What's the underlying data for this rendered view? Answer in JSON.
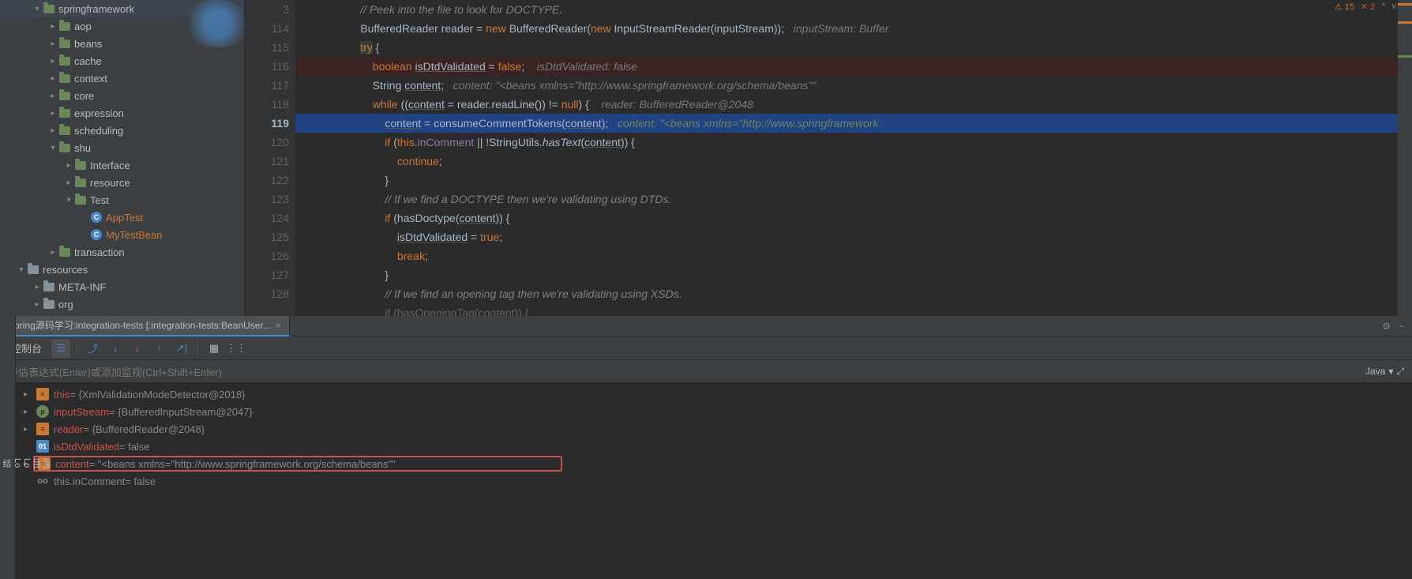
{
  "tree": {
    "springframework": "springframework",
    "aop": "aop",
    "beans": "beans",
    "cache": "cache",
    "context": "context",
    "core": "core",
    "expression": "expression",
    "scheduling": "scheduling",
    "shu": "shu",
    "interface": "Interface",
    "resource": "resource",
    "test": "Test",
    "apptest": "AppTest",
    "mytestbean": "MyTestBean",
    "transaction": "transaction",
    "resources": "resources",
    "metainf": "META-INF",
    "org": "org"
  },
  "gutter": [
    "3",
    "114",
    "115",
    "116",
    "117",
    "118",
    "119",
    "120",
    "121",
    "122",
    "123",
    "124",
    "125",
    "126",
    "127",
    "128",
    ""
  ],
  "code": {
    "l0": {
      "indent": "                ",
      "c": "// Peek into the file to look for DOCTYPE."
    },
    "l1": {
      "indent": "                ",
      "a": "BufferedReader reader = ",
      "b": "new",
      "c": " BufferedReader(",
      "d": "new",
      "e": " InputStreamReader(inputStream));",
      "inlay": "   inputStream: Buffer"
    },
    "l2": {
      "indent": "                ",
      "a": "try",
      "b": " {"
    },
    "l3": {
      "indent": "                    ",
      "a": "boolean ",
      "b": "isDtdValidated",
      "c": " = ",
      "d": "false",
      "e": ";",
      "inlay": "    isDtdValidated: false"
    },
    "l4": {
      "indent": "                    ",
      "a": "String ",
      "b": "content",
      "c": ";",
      "inlay": "   content: \"<beans xmlns=\"http://www.springframework.org/schema/beans\"\""
    },
    "l5": {
      "indent": "                    ",
      "a": "while ",
      "b": "((",
      "c": "content",
      "d": " = reader.readLine()) != ",
      "e": "null",
      "f": ") {",
      "inlay": "    reader: BufferedReader@2048"
    },
    "l6": {
      "indent": "                        ",
      "a": "content",
      "b": " = consumeCommentTokens(",
      "c": "content",
      "d": ");",
      "inlay": "   content: \"<beans xmlns=\"http://www.springframework"
    },
    "l7": {
      "indent": "                        ",
      "a": "if ",
      "b": "(",
      "c": "this",
      "d": ".",
      "e": "inComment",
      "f": " || !StringUtils.",
      "g": "hasText",
      "h": "(",
      "i": "content",
      "j": ")) {"
    },
    "l8": {
      "indent": "                            ",
      "a": "continue",
      "b": ";"
    },
    "l9": {
      "indent": "                        ",
      "a": "}"
    },
    "l10": {
      "indent": "                        ",
      "c": "// If we find a DOCTYPE then we're validating using DTDs."
    },
    "l11": {
      "indent": "                        ",
      "a": "if ",
      "b": "(hasDoctype(",
      "c": "content",
      "d": ")) {"
    },
    "l12": {
      "indent": "                            ",
      "a": "isDtdValidated",
      "b": " = ",
      "c": "true",
      "d": ";"
    },
    "l13": {
      "indent": "                            ",
      "a": "break",
      "b": ";"
    },
    "l14": {
      "indent": "                        ",
      "a": "}"
    },
    "l15": {
      "indent": "                        ",
      "c": "// If we find an opening tag then we're validating using XSDs."
    },
    "l16": {
      "indent": "                        ",
      "a": "if (hasOpeningTag(content)) {"
    }
  },
  "tab": {
    "title": "Spring源码学习:integration-tests [:integration-tests:BeanUser...",
    "close": "×",
    "gear": "⚙",
    "min": "−"
  },
  "toolbar": {
    "console": "控制台"
  },
  "eval": {
    "placeholder": "评估表达式(Enter)或添加监视(Ctrl+Shift+Enter)",
    "lang": "Java"
  },
  "vars": {
    "v0": {
      "name": "this",
      "val": " = {XmlValidationModeDetector@2018}"
    },
    "v1": {
      "name": "inputStream",
      "val": " = {BufferedInputStream@2047}"
    },
    "v2": {
      "name": "reader",
      "val": " = {BufferedReader@2048}"
    },
    "v3": {
      "name": "isDtdValidated",
      "val": " = false"
    },
    "v4": {
      "name": "content",
      "val": " = \"<beans xmlns=\"http://www.springframework.org/schema/beans\"\""
    },
    "v5": {
      "name": "this.inComment",
      "val": " = false"
    }
  },
  "leftstrip": {
    "a": "结",
    "b": "Lo",
    "c": "Lo",
    "d": "dB",
    "e": "dB"
  },
  "status": {
    "a": "⚠ 15",
    "b": "✕ 2"
  }
}
